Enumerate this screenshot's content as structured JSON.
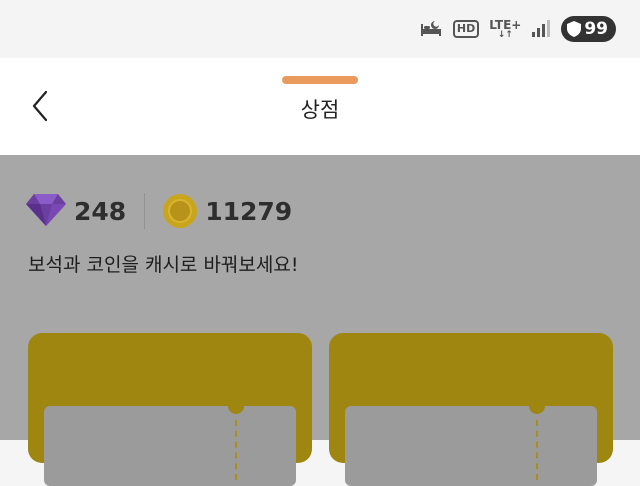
{
  "status_bar": {
    "hd_label": "HD",
    "lte_label": "LTE+",
    "battery_level": "99",
    "icons": [
      "sleep-mode-icon",
      "hd-voice-icon",
      "lte-icon",
      "signal-icon",
      "battery-shield-icon"
    ]
  },
  "header": {
    "title": "상점",
    "back_icon": "chevron-left-icon",
    "handle_color": "#e99a5c"
  },
  "balance": {
    "gems": "248",
    "coins": "11279",
    "gem_color": "#6b3fa0",
    "coin_color": "#c9a51e"
  },
  "message": "보석과 코인을 캐시로 바꿔보세요!",
  "cards": [
    {
      "name": "exchange-card-1",
      "color": "#9f8611"
    },
    {
      "name": "exchange-card-2",
      "color": "#9f8611"
    }
  ]
}
